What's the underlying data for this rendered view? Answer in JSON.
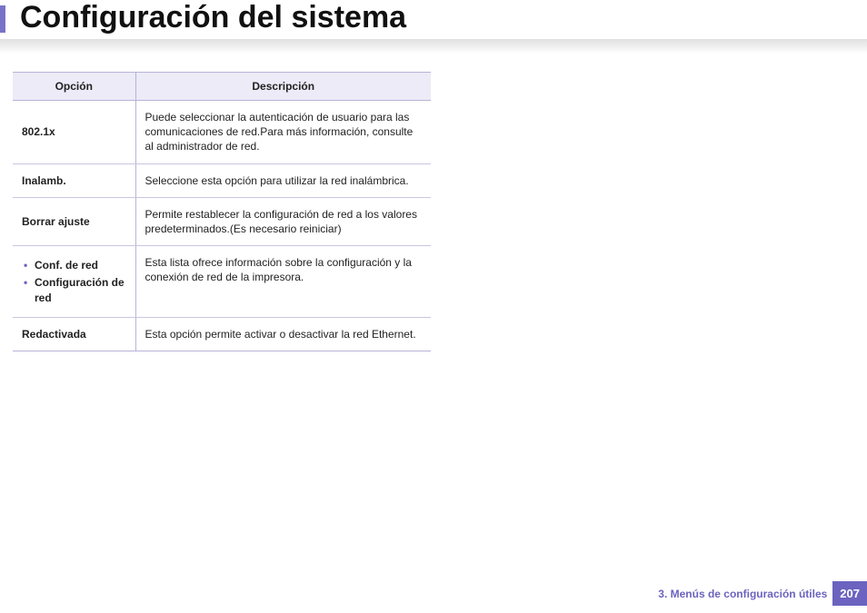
{
  "header": {
    "title": "Configuración del sistema"
  },
  "table": {
    "headers": {
      "option": "Opción",
      "description": "Descripción"
    },
    "rows": [
      {
        "option_plain": "802.1x",
        "description": "Puede seleccionar la autenticación de usuario para las comunicaciones de red.Para más información, consulte al administrador de red."
      },
      {
        "option_plain": "Inalamb.",
        "description": "Seleccione esta opción para utilizar la red inalámbrica."
      },
      {
        "option_plain": "Borrar ajuste",
        "description": "Permite restablecer la configuración de red a los valores predeterminados.(Es necesario reiniciar)"
      },
      {
        "option_list": [
          "Conf. de red",
          "Configuración de red"
        ],
        "description": "Esta lista ofrece información sobre la configuración y la conexión de red de la impresora."
      },
      {
        "option_plain": "Redactivada",
        "description": "Esta opción permite activar o desactivar la red Ethernet."
      }
    ]
  },
  "footer": {
    "chapter": "3.  Menús de configuración útiles",
    "page_number": "207"
  },
  "colors": {
    "accent": "#6b63bf",
    "header_bg": "#ecebf7",
    "border": "#b7b3d8"
  }
}
